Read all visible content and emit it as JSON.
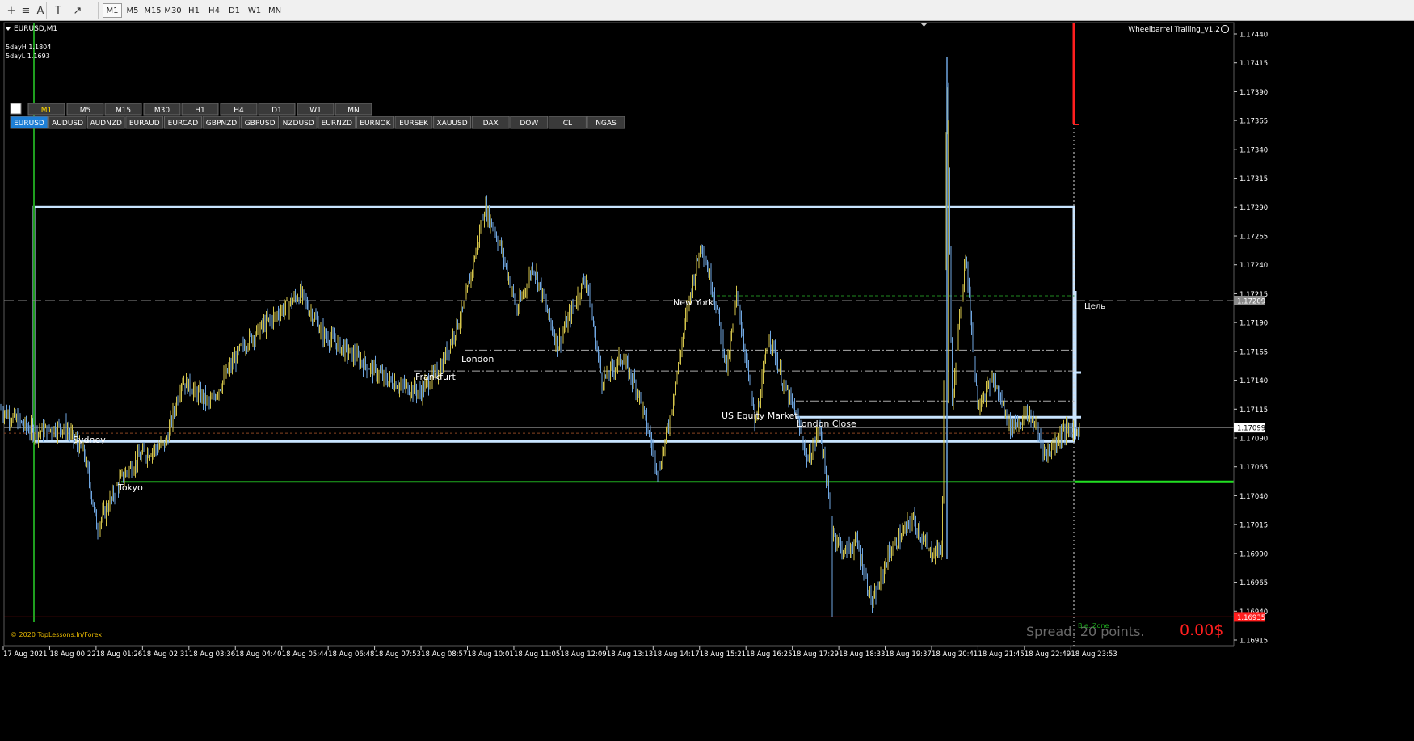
{
  "toolbar": {
    "tools": [
      "crosshair-icon",
      "period-separators-icon",
      "text-tool-icon",
      "text-label-icon",
      "arrows-tool-icon"
    ],
    "tool_glyphs": [
      "+",
      "≡",
      "A",
      "T",
      "↗"
    ],
    "timeframes": [
      "M1",
      "M5",
      "M15",
      "M30",
      "H1",
      "H4",
      "D1",
      "W1",
      "MN"
    ],
    "active_timeframe": "M1"
  },
  "chart": {
    "symbol_label": "EURUSD,M1",
    "info_high": "5dayH 1.1804",
    "info_low": "5dayL 1.1693",
    "indicator_name": "Wheelbarrel Trailing_v1.2",
    "copyright": "© 2020 TopLessons.In/Forex",
    "spread_text": "Spread: 20 points.",
    "profit_text": "0.00$",
    "be_zone_label": "B.e. Zone",
    "target_label": "Цель",
    "current_price": "1.17099",
    "target_price": "1.17209",
    "low_marker_price": "1.16935",
    "colors": {
      "bull": "#d4c44a",
      "bear": "#6fa6e0",
      "session_box": "#c8e4ff",
      "green_line": "#1fd11f",
      "red_marker": "#ff1e1e"
    }
  },
  "panel": {
    "timeframes": [
      "M1",
      "M5",
      "M15",
      "M30",
      "H1",
      "H4",
      "D1",
      "W1",
      "MN"
    ],
    "active_timeframe": "M1",
    "symbols": [
      "EURUSD",
      "AUDUSD",
      "AUDNZD",
      "EURAUD",
      "EURCAD",
      "GBPNZD",
      "GBPUSD",
      "NZDUSD",
      "EURNZD",
      "EURNOK",
      "EURSEK",
      "XAUUSD",
      "DAX",
      "DOW",
      "CL",
      "NGAS"
    ],
    "active_symbol": "EURUSD"
  },
  "sessions": [
    "Sydney",
    "Tokyo",
    "Frankfurt",
    "London",
    "New York",
    "US Equity Market",
    "London Close"
  ],
  "price_axis": [
    "1.17440",
    "1.17415",
    "1.17390",
    "1.17365",
    "1.17340",
    "1.17315",
    "1.17290",
    "1.17265",
    "1.17240",
    "1.17215",
    "1.17190",
    "1.17165",
    "1.17140",
    "1.17115",
    "1.17090",
    "1.17065",
    "1.17040",
    "1.17015",
    "1.16990",
    "1.16965",
    "1.16940",
    "1.16915"
  ],
  "time_axis": [
    "17 Aug 2021",
    "18 Aug 00:22",
    "18 Aug 01:26",
    "18 Aug 02:31",
    "18 Aug 03:36",
    "18 Aug 04:40",
    "18 Aug 05:44",
    "18 Aug 06:48",
    "18 Aug 07:53",
    "18 Aug 08:57",
    "18 Aug 10:01",
    "18 Aug 11:05",
    "18 Aug 12:09",
    "18 Aug 13:13",
    "18 Aug 14:17",
    "18 Aug 15:21",
    "18 Aug 16:25",
    "18 Aug 17:29",
    "18 Aug 18:33",
    "18 Aug 19:37",
    "18 Aug 20:41",
    "18 Aug 21:45",
    "18 Aug 22:49",
    "18 Aug 23:53"
  ],
  "chart_data": {
    "type": "candlestick",
    "symbol": "EURUSD",
    "timeframe": "M1",
    "ylim": [
      1.16905,
      1.1745
    ],
    "session_box": {
      "high": 1.1729,
      "low": 1.17087
    },
    "levels": {
      "green_support": 1.17052,
      "target": 1.17209,
      "current": 1.17099,
      "low_marker": 1.16935
    },
    "path_anchors": [
      [
        0,
        1.17115
      ],
      [
        42,
        1.17095
      ],
      [
        80,
        1.171
      ],
      [
        105,
        1.17075
      ],
      [
        120,
        1.17012
      ],
      [
        150,
        1.17055
      ],
      [
        175,
        1.17075
      ],
      [
        205,
        1.17085
      ],
      [
        225,
        1.1714
      ],
      [
        260,
        1.1712
      ],
      [
        300,
        1.1717
      ],
      [
        330,
        1.1719
      ],
      [
        372,
        1.17215
      ],
      [
        400,
        1.1718
      ],
      [
        440,
        1.1716
      ],
      [
        480,
        1.1714
      ],
      [
        520,
        1.1713
      ],
      [
        545,
        1.1715
      ],
      [
        575,
        1.17205
      ],
      [
        600,
        1.1729
      ],
      [
        620,
        1.17255
      ],
      [
        640,
        1.172
      ],
      [
        660,
        1.1724
      ],
      [
        690,
        1.1717
      ],
      [
        725,
        1.1723
      ],
      [
        745,
        1.1714
      ],
      [
        770,
        1.1716
      ],
      [
        790,
        1.1713
      ],
      [
        815,
        1.1706
      ],
      [
        830,
        1.1711
      ],
      [
        850,
        1.172
      ],
      [
        868,
        1.1726
      ],
      [
        885,
        1.1721
      ],
      [
        900,
        1.1715
      ],
      [
        912,
        1.17215
      ],
      [
        935,
        1.171
      ],
      [
        952,
        1.1718
      ],
      [
        968,
        1.1714
      ],
      [
        985,
        1.1711
      ],
      [
        1000,
        1.1707
      ],
      [
        1015,
        1.171
      ],
      [
        1030,
        1.1701
      ],
      [
        1045,
        1.1699
      ],
      [
        1060,
        1.17
      ],
      [
        1080,
        1.16945
      ],
      [
        1100,
        1.1699
      ],
      [
        1130,
        1.1702
      ],
      [
        1150,
        1.1699
      ],
      [
        1166,
        1.16995
      ],
      [
        1172,
        1.1742
      ],
      [
        1178,
        1.1712
      ],
      [
        1195,
        1.1725
      ],
      [
        1210,
        1.1712
      ],
      [
        1230,
        1.1714
      ],
      [
        1250,
        1.171
      ],
      [
        1275,
        1.1711
      ],
      [
        1295,
        1.17075
      ],
      [
        1315,
        1.17095
      ],
      [
        1336,
        1.17099
      ]
    ]
  }
}
